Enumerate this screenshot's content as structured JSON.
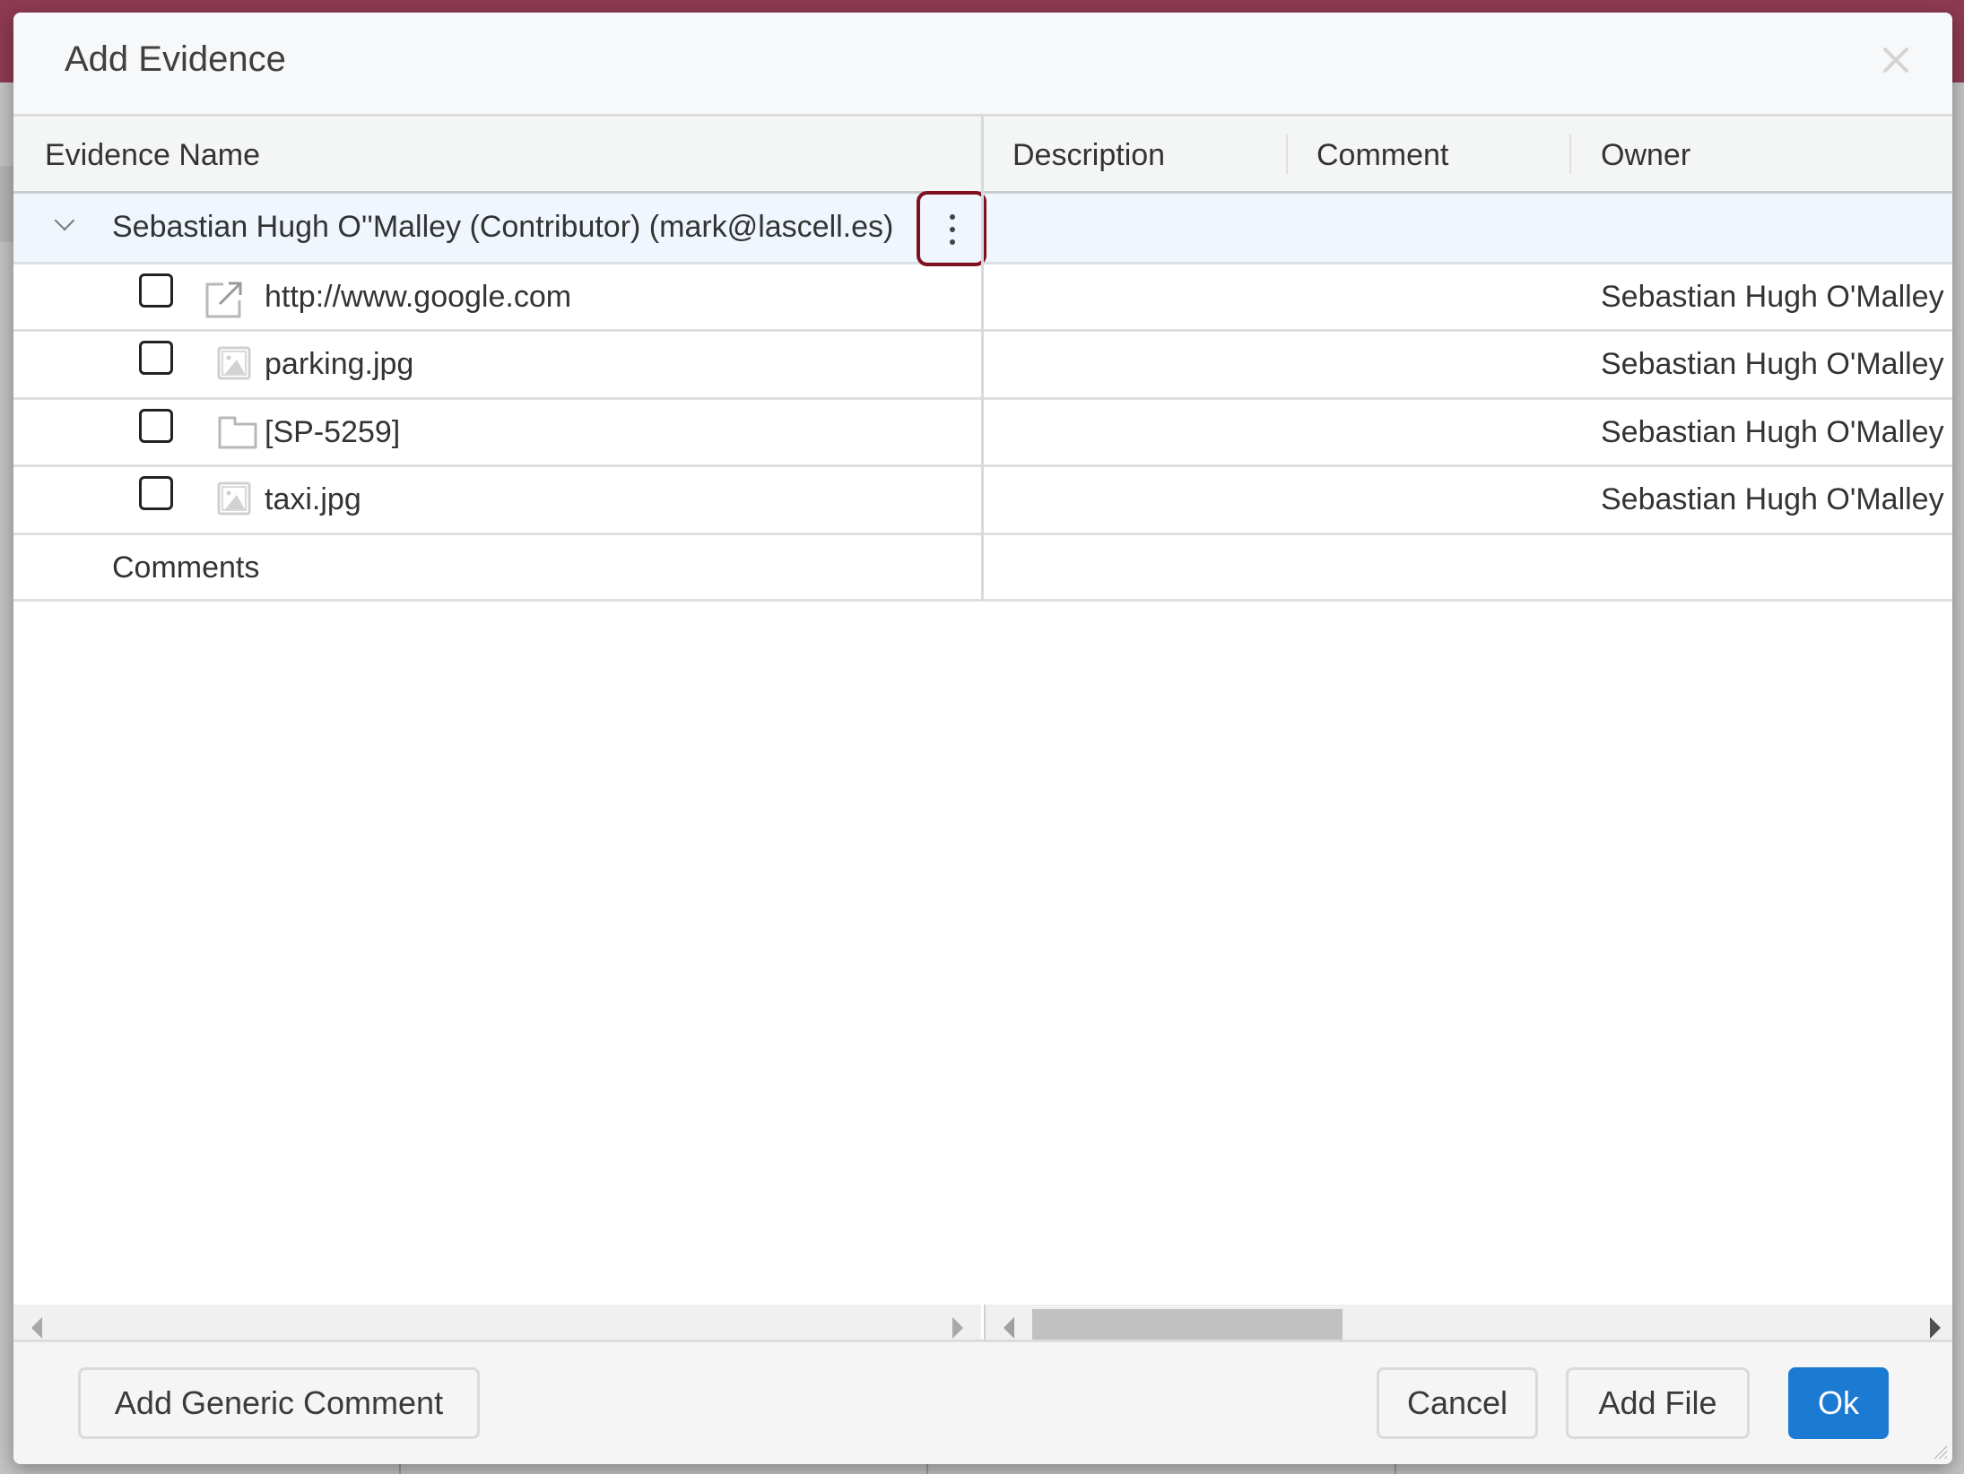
{
  "dialog": {
    "title": "Add Evidence",
    "close_icon": "close-icon"
  },
  "grid": {
    "columns": [
      {
        "label": "Evidence Name"
      },
      {
        "label": "Description"
      },
      {
        "label": "Comment"
      },
      {
        "label": "Owner"
      }
    ],
    "group": {
      "label": "Sebastian Hugh O''Malley (Contributor) (mark@lascell.es)",
      "expanded": true,
      "menu_icon": "more-vertical-icon"
    },
    "rows": [
      {
        "name": "http://www.google.com",
        "type_icon": "external-link-icon",
        "description": "",
        "comment": "",
        "owner": "Sebastian Hugh O'Malley",
        "checked": false
      },
      {
        "name": "parking.jpg",
        "type_icon": "image-icon",
        "description": "",
        "comment": "",
        "owner": "Sebastian Hugh O'Malley",
        "checked": false
      },
      {
        "name": "[SP-5259]",
        "type_icon": "folder-icon",
        "description": "",
        "comment": "",
        "owner": "Sebastian Hugh O'Malley",
        "checked": false
      },
      {
        "name": "taxi.jpg",
        "type_icon": "image-icon",
        "description": "",
        "comment": "",
        "owner": "Sebastian Hugh O'Malley",
        "checked": false
      }
    ],
    "comments_row": {
      "label": "Comments"
    }
  },
  "footer": {
    "add_generic_comment": "Add Generic Comment",
    "cancel": "Cancel",
    "add_file": "Add File",
    "ok": "Ok"
  },
  "colors": {
    "primary": "#1b7ad1",
    "focus_outline": "#7e1020",
    "header_bar": "#8e3a52",
    "group_row_bg": "#eff6fd"
  }
}
